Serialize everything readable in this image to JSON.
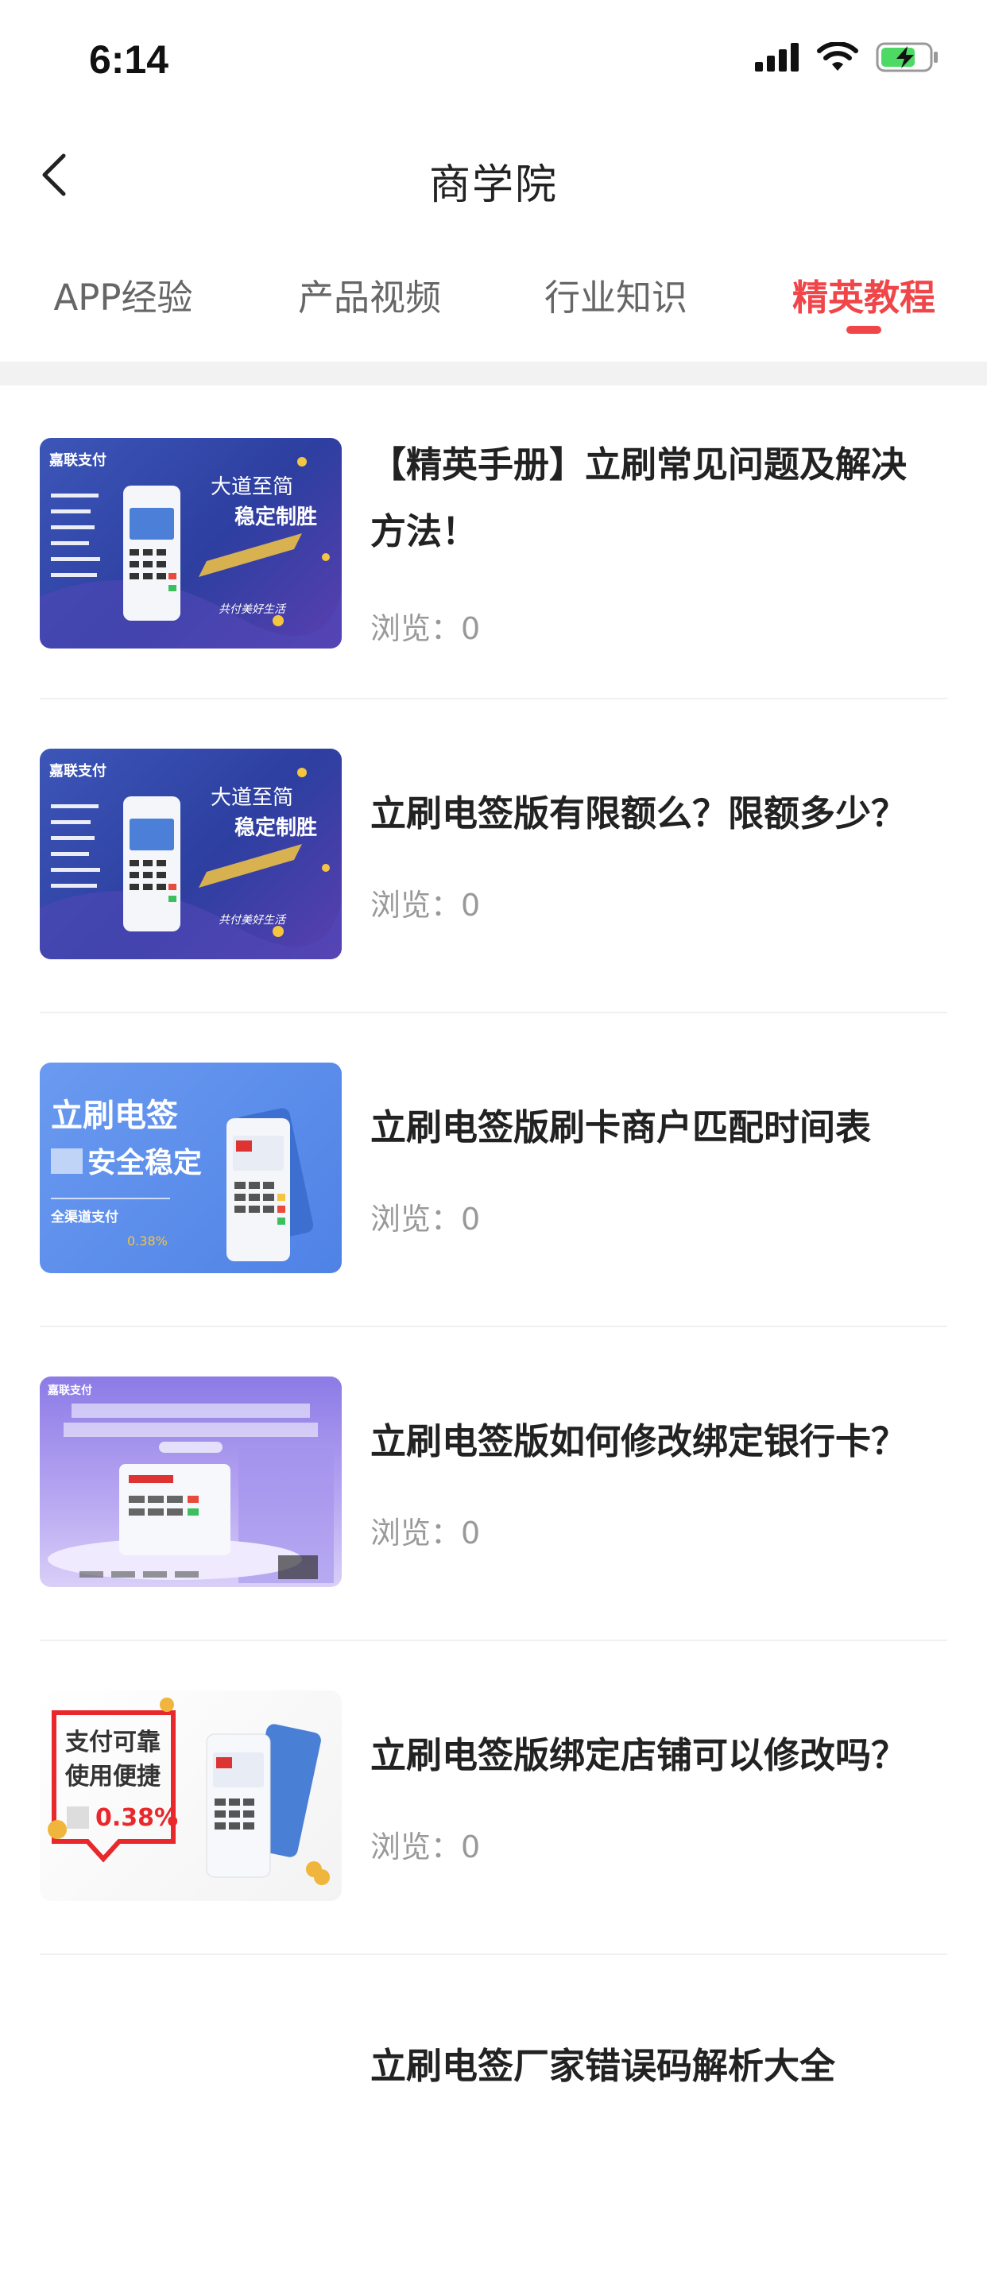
{
  "status_bar": {
    "time": "6:14"
  },
  "nav": {
    "title": "商学院"
  },
  "tabs": [
    {
      "label": "APP经验",
      "active": false
    },
    {
      "label": "产品视频",
      "active": false
    },
    {
      "label": "行业知识",
      "active": false
    },
    {
      "label": "精英教程",
      "active": true
    }
  ],
  "items": [
    {
      "title_line1": "【精英手册】立刷常见问题及解决",
      "title_line2": "方法！",
      "views": "浏览：0",
      "thumb": {
        "brand": "嘉联支付",
        "headline1": "大道至简",
        "headline2": "稳定制胜",
        "slogan": "共付美好生活"
      }
    },
    {
      "title_line1": "立刷电签版有限额么？限额多少？",
      "title_line2": "",
      "views": "浏览：0",
      "thumb": {
        "brand": "嘉联支付",
        "headline1": "大道至简",
        "headline2": "稳定制胜",
        "slogan": "共付美好生活"
      }
    },
    {
      "title_line1": "立刷电签版刷卡商户匹配时间表",
      "title_line2": "",
      "views": "浏览：0",
      "thumb": {
        "headline1": "立刷电签",
        "headline2": "安全稳定",
        "sub": "全渠道支付",
        "rate": "0.38%"
      }
    },
    {
      "title_line1": "立刷电签版如何修改绑定银行卡？",
      "title_line2": "",
      "views": "浏览：0",
      "thumb": {
        "brand": "嘉联支付"
      }
    },
    {
      "title_line1": "立刷电签版绑定店铺可以修改吗？",
      "title_line2": "",
      "views": "浏览：0",
      "thumb": {
        "headline1": "支付可靠",
        "headline2": "使用便捷",
        "rate": "0.38%"
      }
    },
    {
      "title_line1": "立刷电签厂家错误码解析大全",
      "title_line2": "",
      "views": "",
      "thumb": {}
    }
  ],
  "colors": {
    "accent": "#f0464a",
    "tab_inactive": "#666666",
    "views_text": "#999999"
  }
}
